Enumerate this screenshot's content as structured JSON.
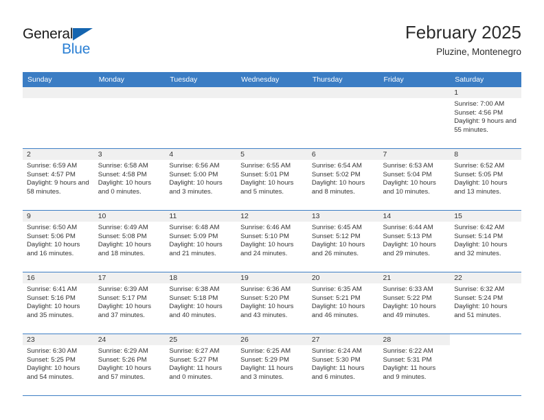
{
  "brand": {
    "name_part1": "General",
    "name_part2": "Blue",
    "triangle_color": "#1565b0",
    "blue_color": "#2a7fd4"
  },
  "header": {
    "month_year": "February 2025",
    "location": "Pluzine, Montenegro"
  },
  "theme": {
    "header_band": "#3b7dc4",
    "day_band": "#f0f0f0",
    "grid_line": "#3b7dc4",
    "text": "#333333"
  },
  "calendar": {
    "weekday_headers": [
      "Sunday",
      "Monday",
      "Tuesday",
      "Wednesday",
      "Thursday",
      "Friday",
      "Saturday"
    ],
    "weeks": [
      [
        {
          "day": "",
          "empty": true,
          "blank": false
        },
        {
          "day": "",
          "empty": true,
          "blank": false
        },
        {
          "day": "",
          "empty": true,
          "blank": false
        },
        {
          "day": "",
          "empty": true,
          "blank": false
        },
        {
          "day": "",
          "empty": true,
          "blank": false
        },
        {
          "day": "",
          "empty": true,
          "blank": false
        },
        {
          "day": "1",
          "sunrise": "Sunrise: 7:00 AM",
          "sunset": "Sunset: 4:56 PM",
          "daylight": "Daylight: 9 hours and 55 minutes."
        }
      ],
      [
        {
          "day": "2",
          "sunrise": "Sunrise: 6:59 AM",
          "sunset": "Sunset: 4:57 PM",
          "daylight": "Daylight: 9 hours and 58 minutes."
        },
        {
          "day": "3",
          "sunrise": "Sunrise: 6:58 AM",
          "sunset": "Sunset: 4:58 PM",
          "daylight": "Daylight: 10 hours and 0 minutes."
        },
        {
          "day": "4",
          "sunrise": "Sunrise: 6:56 AM",
          "sunset": "Sunset: 5:00 PM",
          "daylight": "Daylight: 10 hours and 3 minutes."
        },
        {
          "day": "5",
          "sunrise": "Sunrise: 6:55 AM",
          "sunset": "Sunset: 5:01 PM",
          "daylight": "Daylight: 10 hours and 5 minutes."
        },
        {
          "day": "6",
          "sunrise": "Sunrise: 6:54 AM",
          "sunset": "Sunset: 5:02 PM",
          "daylight": "Daylight: 10 hours and 8 minutes."
        },
        {
          "day": "7",
          "sunrise": "Sunrise: 6:53 AM",
          "sunset": "Sunset: 5:04 PM",
          "daylight": "Daylight: 10 hours and 10 minutes."
        },
        {
          "day": "8",
          "sunrise": "Sunrise: 6:52 AM",
          "sunset": "Sunset: 5:05 PM",
          "daylight": "Daylight: 10 hours and 13 minutes."
        }
      ],
      [
        {
          "day": "9",
          "sunrise": "Sunrise: 6:50 AM",
          "sunset": "Sunset: 5:06 PM",
          "daylight": "Daylight: 10 hours and 16 minutes."
        },
        {
          "day": "10",
          "sunrise": "Sunrise: 6:49 AM",
          "sunset": "Sunset: 5:08 PM",
          "daylight": "Daylight: 10 hours and 18 minutes."
        },
        {
          "day": "11",
          "sunrise": "Sunrise: 6:48 AM",
          "sunset": "Sunset: 5:09 PM",
          "daylight": "Daylight: 10 hours and 21 minutes."
        },
        {
          "day": "12",
          "sunrise": "Sunrise: 6:46 AM",
          "sunset": "Sunset: 5:10 PM",
          "daylight": "Daylight: 10 hours and 24 minutes."
        },
        {
          "day": "13",
          "sunrise": "Sunrise: 6:45 AM",
          "sunset": "Sunset: 5:12 PM",
          "daylight": "Daylight: 10 hours and 26 minutes."
        },
        {
          "day": "14",
          "sunrise": "Sunrise: 6:44 AM",
          "sunset": "Sunset: 5:13 PM",
          "daylight": "Daylight: 10 hours and 29 minutes."
        },
        {
          "day": "15",
          "sunrise": "Sunrise: 6:42 AM",
          "sunset": "Sunset: 5:14 PM",
          "daylight": "Daylight: 10 hours and 32 minutes."
        }
      ],
      [
        {
          "day": "16",
          "sunrise": "Sunrise: 6:41 AM",
          "sunset": "Sunset: 5:16 PM",
          "daylight": "Daylight: 10 hours and 35 minutes."
        },
        {
          "day": "17",
          "sunrise": "Sunrise: 6:39 AM",
          "sunset": "Sunset: 5:17 PM",
          "daylight": "Daylight: 10 hours and 37 minutes."
        },
        {
          "day": "18",
          "sunrise": "Sunrise: 6:38 AM",
          "sunset": "Sunset: 5:18 PM",
          "daylight": "Daylight: 10 hours and 40 minutes."
        },
        {
          "day": "19",
          "sunrise": "Sunrise: 6:36 AM",
          "sunset": "Sunset: 5:20 PM",
          "daylight": "Daylight: 10 hours and 43 minutes."
        },
        {
          "day": "20",
          "sunrise": "Sunrise: 6:35 AM",
          "sunset": "Sunset: 5:21 PM",
          "daylight": "Daylight: 10 hours and 46 minutes."
        },
        {
          "day": "21",
          "sunrise": "Sunrise: 6:33 AM",
          "sunset": "Sunset: 5:22 PM",
          "daylight": "Daylight: 10 hours and 49 minutes."
        },
        {
          "day": "22",
          "sunrise": "Sunrise: 6:32 AM",
          "sunset": "Sunset: 5:24 PM",
          "daylight": "Daylight: 10 hours and 51 minutes."
        }
      ],
      [
        {
          "day": "23",
          "sunrise": "Sunrise: 6:30 AM",
          "sunset": "Sunset: 5:25 PM",
          "daylight": "Daylight: 10 hours and 54 minutes."
        },
        {
          "day": "24",
          "sunrise": "Sunrise: 6:29 AM",
          "sunset": "Sunset: 5:26 PM",
          "daylight": "Daylight: 10 hours and 57 minutes."
        },
        {
          "day": "25",
          "sunrise": "Sunrise: 6:27 AM",
          "sunset": "Sunset: 5:27 PM",
          "daylight": "Daylight: 11 hours and 0 minutes."
        },
        {
          "day": "26",
          "sunrise": "Sunrise: 6:25 AM",
          "sunset": "Sunset: 5:29 PM",
          "daylight": "Daylight: 11 hours and 3 minutes."
        },
        {
          "day": "27",
          "sunrise": "Sunrise: 6:24 AM",
          "sunset": "Sunset: 5:30 PM",
          "daylight": "Daylight: 11 hours and 6 minutes."
        },
        {
          "day": "28",
          "sunrise": "Sunrise: 6:22 AM",
          "sunset": "Sunset: 5:31 PM",
          "daylight": "Daylight: 11 hours and 9 minutes."
        },
        {
          "day": "",
          "empty": true,
          "blank": true
        }
      ]
    ]
  }
}
